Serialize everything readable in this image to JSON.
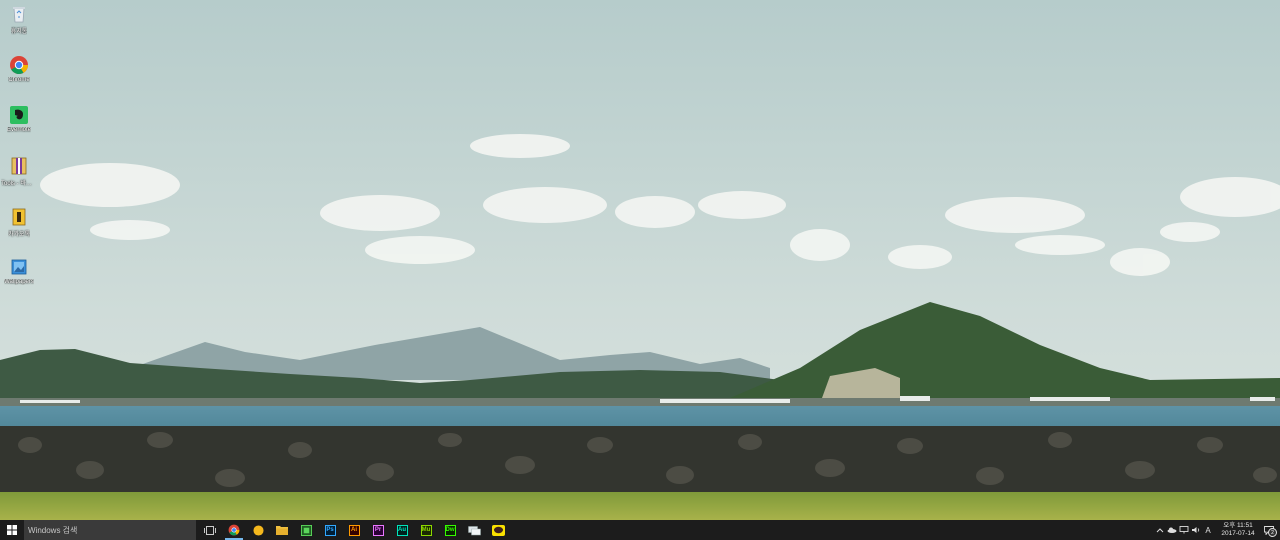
{
  "desktop": {
    "icons": [
      {
        "label": "휴지통",
        "icon": "recycle-bin-icon"
      },
      {
        "label": "Chrome",
        "icon": "chrome-icon"
      },
      {
        "label": "Evernote",
        "icon": "evernote-icon"
      },
      {
        "label": "Tools - 바로 가기",
        "icon": "archive-icon"
      },
      {
        "label": "카카오톡",
        "icon": "file-icon"
      },
      {
        "label": "Wallpapers",
        "icon": "wallpapers-icon"
      }
    ]
  },
  "taskbar": {
    "search_placeholder": "Windows 검색",
    "apps": [
      {
        "name": "chrome",
        "icon": "chrome-icon",
        "active": true
      },
      {
        "name": "explorer-sun",
        "icon": "yellow-circle-icon",
        "active": false
      },
      {
        "name": "file-explorer",
        "icon": "folder-icon",
        "active": false
      },
      {
        "name": "green-app",
        "icon": "green-square-icon",
        "active": false
      },
      {
        "name": "photoshop",
        "label": "Ps",
        "color": "#31a8ff"
      },
      {
        "name": "illustrator",
        "label": "Ai",
        "color": "#ff9a00"
      },
      {
        "name": "premiere",
        "label": "Pr",
        "color": "#ea77ff"
      },
      {
        "name": "audition",
        "label": "Au",
        "color": "#00e4bb"
      },
      {
        "name": "muse",
        "label": "Mu",
        "color": "#8cd700"
      },
      {
        "name": "dreamweaver",
        "label": "Dw",
        "color": "#35fa00"
      },
      {
        "name": "messenger",
        "icon": "chat-icon",
        "active": false
      },
      {
        "name": "kakaotalk",
        "icon": "kakaotalk-icon",
        "active": false
      }
    ],
    "tray": {
      "ime": "A",
      "time": "오후 11:51",
      "date": "2017-07-14",
      "notifications": "2"
    }
  }
}
